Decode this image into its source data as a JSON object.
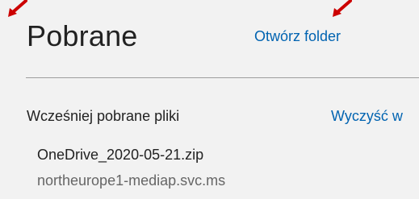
{
  "header": {
    "title": "Pobrane",
    "open_folder_label": "Otwórz folder"
  },
  "section": {
    "title": "Wcześniej pobrane pliki",
    "clear_label": "Wyczyść w"
  },
  "downloads": [
    {
      "file_name": "OneDrive_2020-05-21.zip",
      "source": "northeurope1-mediap.svc.ms"
    }
  ],
  "colors": {
    "panel_background": "#f2f2f2",
    "link": "#0063b1",
    "annotation_arrow": "#cc0000",
    "divider": "#9e9e9e"
  },
  "icons": [
    "annotation-arrow-icon"
  ]
}
